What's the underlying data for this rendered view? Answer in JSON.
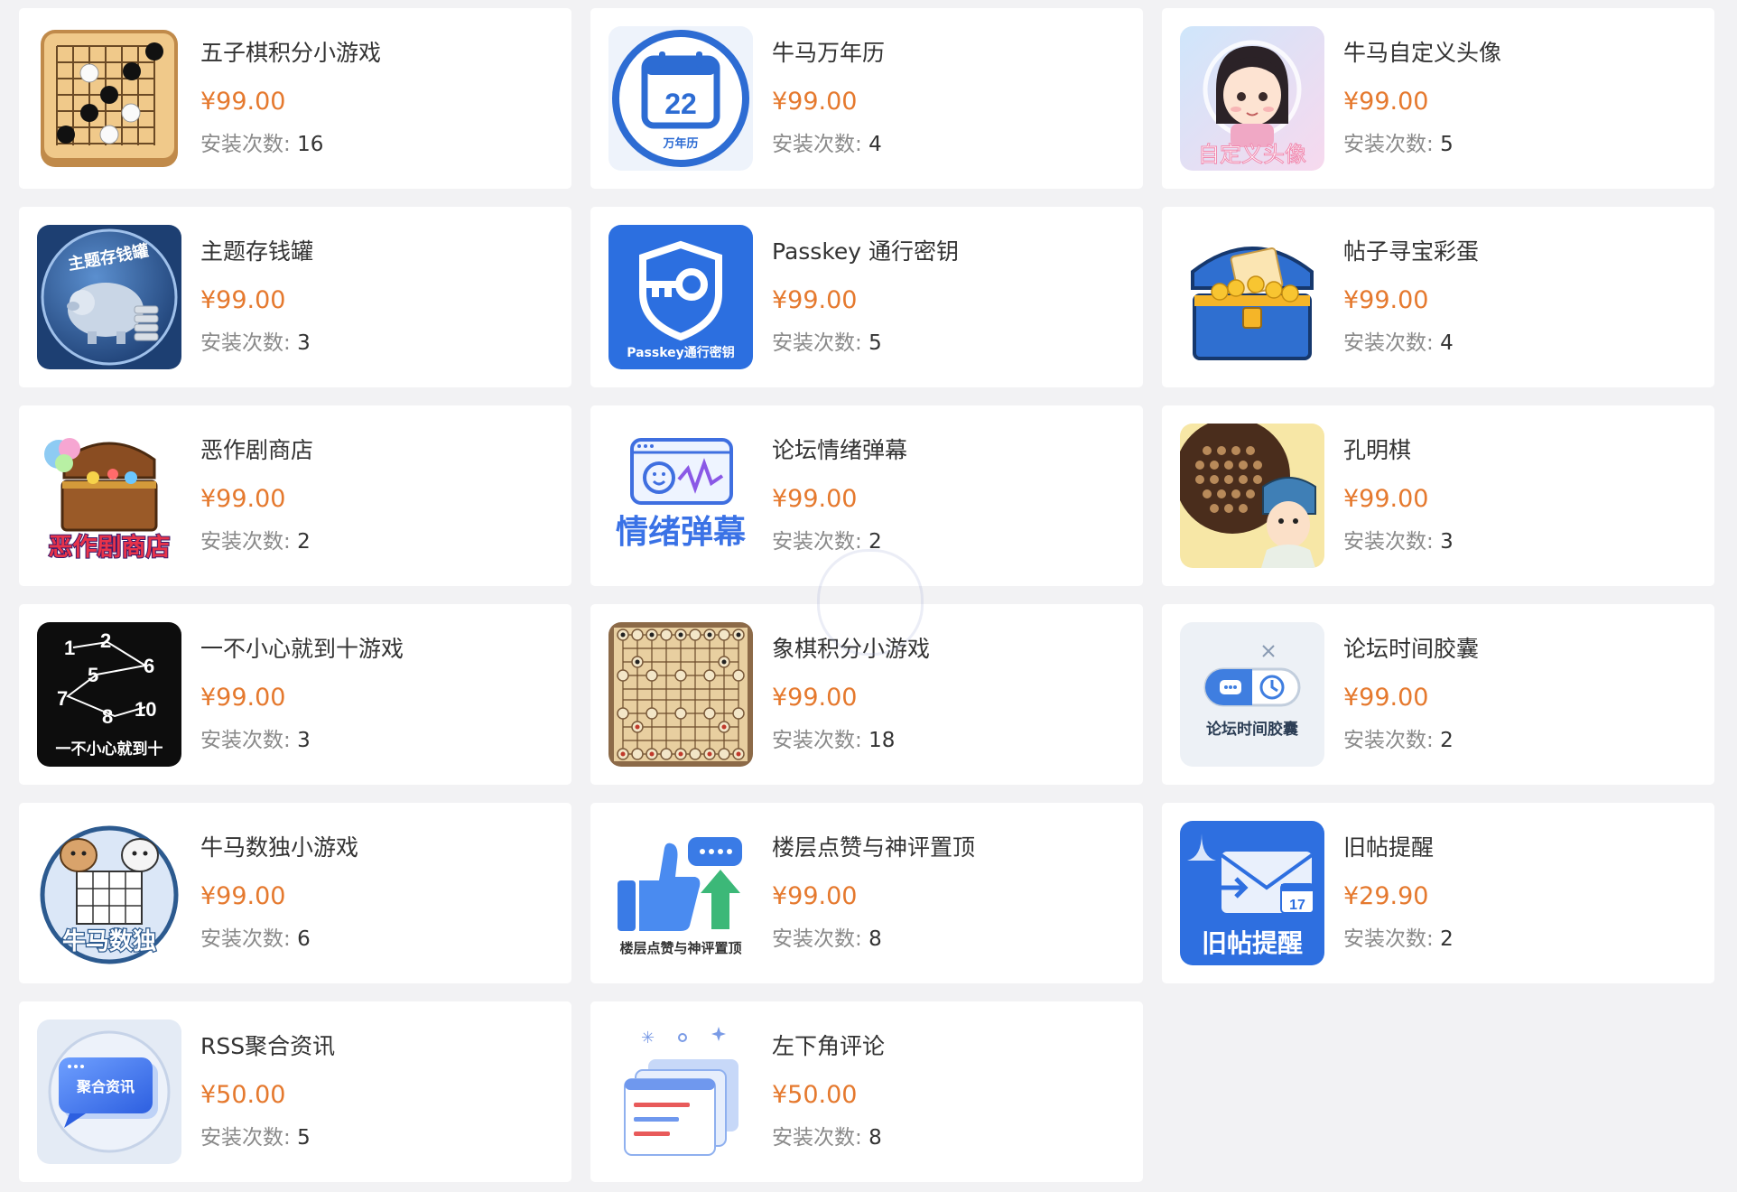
{
  "installs_label": "安装次数: ",
  "colors": {
    "price": "#e5792e",
    "title": "#333333",
    "meta": "#8a8a8a",
    "card": "#ffffff",
    "background": "#f2f2f4"
  },
  "apps": [
    {
      "name": "五子棋积分小游戏",
      "price": "¥99.00",
      "installs": "16",
      "icon": "gomoku-board-icon"
    },
    {
      "name": "牛马万年历",
      "price": "¥99.00",
      "installs": "4",
      "icon": "calendar-icon",
      "icon_text": [
        "22",
        "万年历"
      ]
    },
    {
      "name": "牛马自定义头像",
      "price": "¥99.00",
      "installs": "5",
      "icon": "custom-avatar-icon",
      "icon_text": [
        "自定义头像"
      ]
    },
    {
      "name": "主题存钱罐",
      "price": "¥99.00",
      "installs": "3",
      "icon": "piggy-bank-icon",
      "icon_text": [
        "主题存钱罐"
      ]
    },
    {
      "name": "Passkey 通行密钥",
      "price": "¥99.00",
      "installs": "5",
      "icon": "shield-key-icon",
      "icon_text": [
        "Passkey通行密钥"
      ]
    },
    {
      "name": "帖子寻宝彩蛋",
      "price": "¥99.00",
      "installs": "4",
      "icon": "treasure-chest-icon"
    },
    {
      "name": "恶作剧商店",
      "price": "¥99.00",
      "installs": "2",
      "icon": "prank-shop-icon",
      "icon_text": [
        "恶作剧商店"
      ]
    },
    {
      "name": "论坛情绪弹幕",
      "price": "¥99.00",
      "installs": "2",
      "icon": "emotion-danmaku-icon",
      "icon_text": [
        "情绪弹幕"
      ]
    },
    {
      "name": "孔明棋",
      "price": "¥99.00",
      "installs": "3",
      "icon": "peg-solitaire-icon"
    },
    {
      "name": "一不小心就到十游戏",
      "price": "¥99.00",
      "installs": "3",
      "icon": "number-path-icon",
      "icon_text": [
        "1",
        "2",
        "5",
        "6",
        "7",
        "8",
        "10",
        "一不小心就到十"
      ]
    },
    {
      "name": "象棋积分小游戏",
      "price": "¥99.00",
      "installs": "18",
      "icon": "chinese-chess-board-icon"
    },
    {
      "name": "论坛时间胶囊",
      "price": "¥99.00",
      "installs": "2",
      "icon": "time-capsule-icon",
      "icon_text": [
        "论坛时间胶囊"
      ]
    },
    {
      "name": "牛马数独小游戏",
      "price": "¥99.00",
      "installs": "6",
      "icon": "sudoku-cows-icon",
      "icon_text": [
        "牛马数独"
      ]
    },
    {
      "name": "楼层点赞与神评置顶",
      "price": "¥99.00",
      "installs": "8",
      "icon": "thumbs-up-icon",
      "icon_text": [
        "楼层点赞与神评置顶"
      ]
    },
    {
      "name": "旧帖提醒",
      "price": "¥29.90",
      "installs": "2",
      "icon": "reminder-envelope-icon",
      "icon_text": [
        "17",
        "旧帖提醒"
      ]
    },
    {
      "name": "RSS聚合资讯",
      "price": "¥50.00",
      "installs": "5",
      "icon": "rss-news-icon",
      "icon_text": [
        "聚合资讯"
      ]
    },
    {
      "name": "左下角评论",
      "price": "¥50.00",
      "installs": "8",
      "icon": "comment-documents-icon"
    }
  ]
}
